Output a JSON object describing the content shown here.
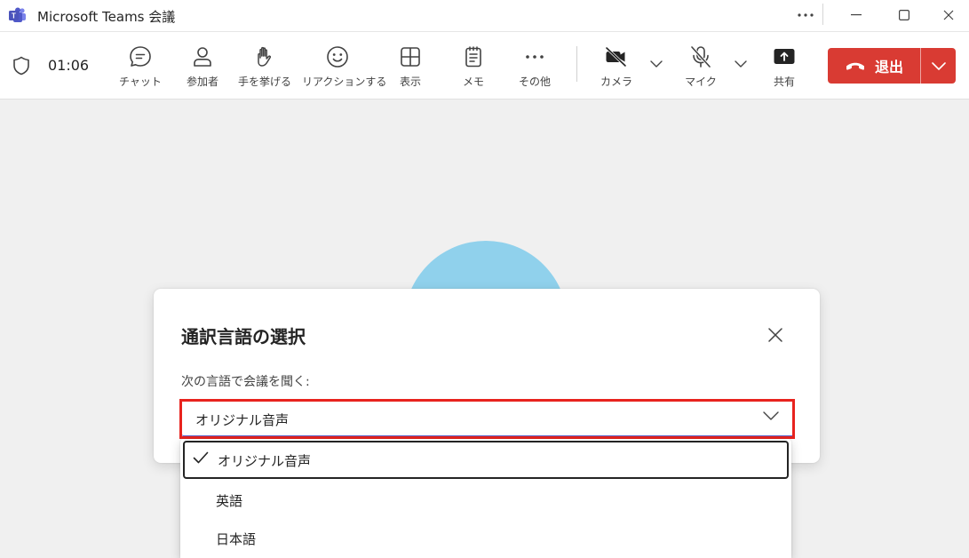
{
  "window": {
    "title": "Microsoft Teams 会議",
    "more_icon": "more-horizontal-icon",
    "minimize_icon": "minimize-icon",
    "maximize_icon": "maximize-icon",
    "close_icon": "close-icon"
  },
  "toolbar": {
    "timer": "01:06",
    "items": [
      {
        "label": "チャット",
        "icon": "chat-icon"
      },
      {
        "label": "参加者",
        "icon": "people-icon"
      },
      {
        "label": "手を挙げる",
        "icon": "raise-hand-icon"
      },
      {
        "label": "リアクションする",
        "icon": "emoji-icon"
      },
      {
        "label": "表示",
        "icon": "grid-icon"
      },
      {
        "label": "メモ",
        "icon": "notes-icon"
      },
      {
        "label": "その他",
        "icon": "more-icon"
      },
      {
        "label": "カメラ",
        "icon": "camera-off-icon"
      },
      {
        "label": "マイク",
        "icon": "mic-off-icon"
      },
      {
        "label": "共有",
        "icon": "share-icon"
      }
    ],
    "leave_label": "退出"
  },
  "dialog": {
    "title": "通訳言語の選択",
    "label": "次の言語で会議を聞く:",
    "selected_value": "オリジナル音声",
    "options": [
      {
        "label": "オリジナル音声",
        "selected": true
      },
      {
        "label": "英語",
        "selected": false
      },
      {
        "label": "日本語",
        "selected": false
      }
    ]
  },
  "colors": {
    "leave_button": "#d93b33",
    "accent": "#5b5fc7",
    "highlight_box": "#e8231e",
    "avatar": "#90d1ec"
  }
}
